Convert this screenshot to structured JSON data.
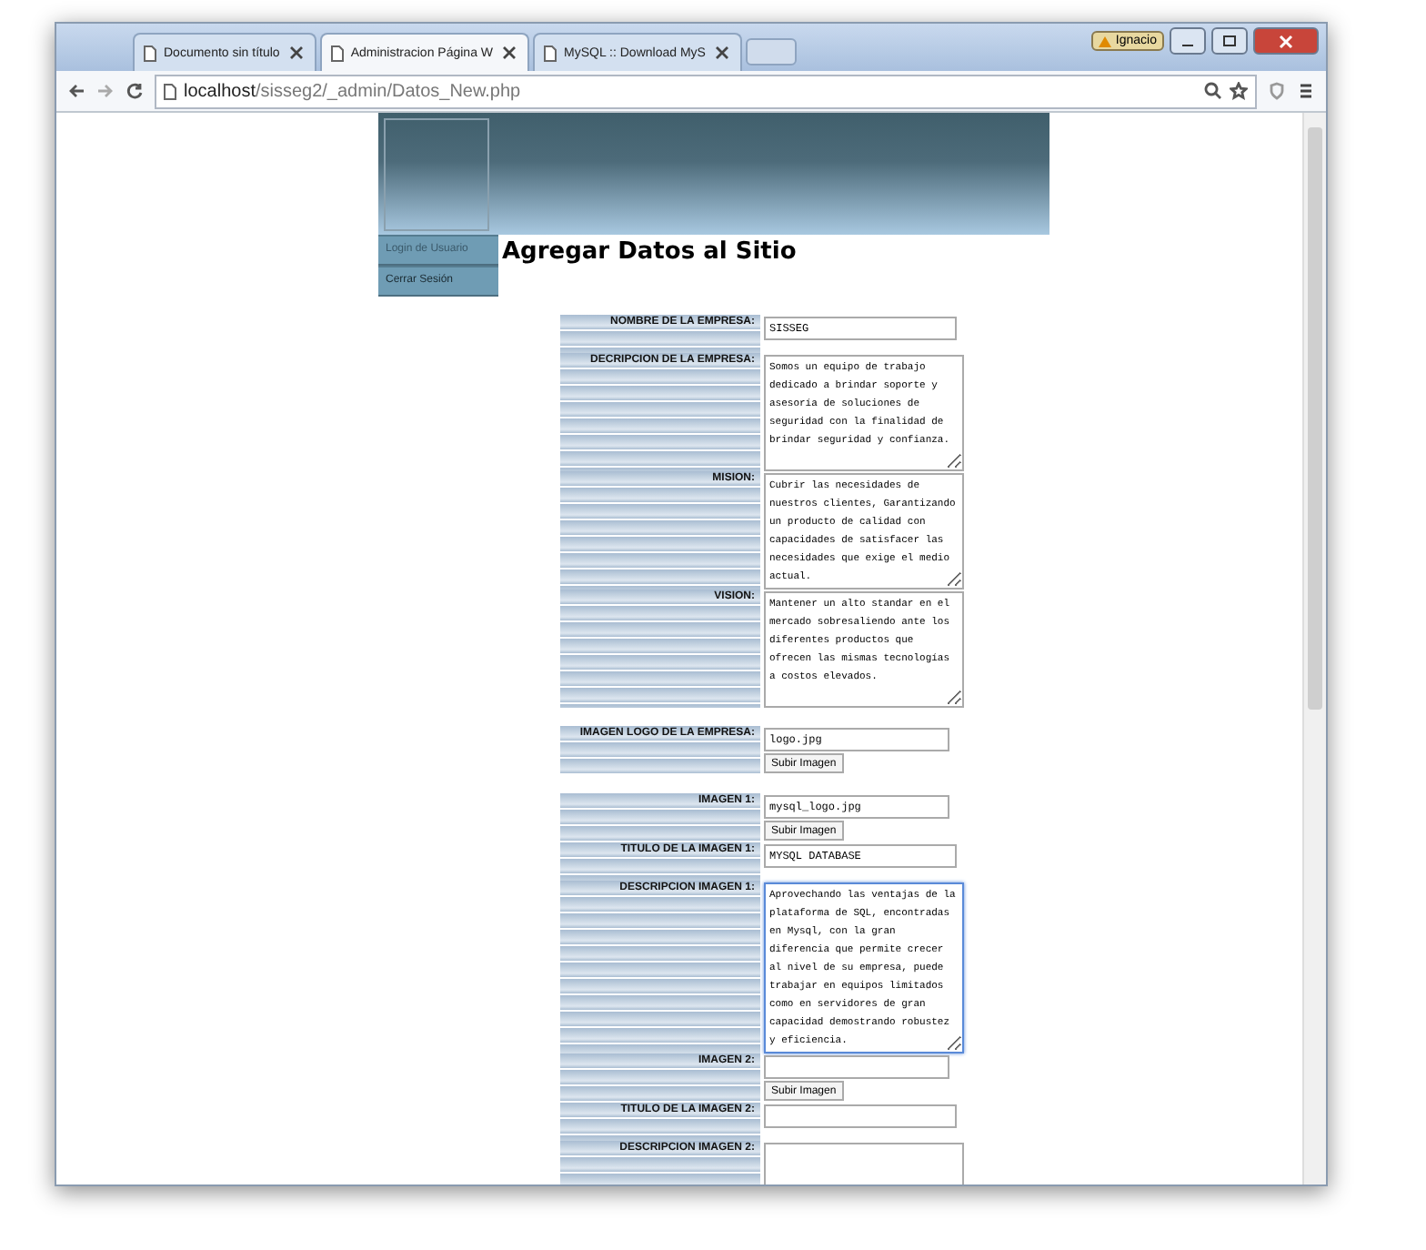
{
  "browser": {
    "tabs": [
      {
        "title": "Documento sin título",
        "selected": false
      },
      {
        "title": "Administracion Página W",
        "selected": true
      },
      {
        "title": "MySQL :: Download MyS",
        "selected": false
      }
    ],
    "profile": "Ignacio",
    "address": {
      "host": "localhost",
      "path": "/sisseg2/_admin/Datos_New.php"
    }
  },
  "menu": [
    {
      "label": "Login de Usuario",
      "disabled": true
    },
    {
      "label": "Cerrar Sesión",
      "disabled": false
    }
  ],
  "heading": "Agregar Datos al Sitio",
  "groups": [
    [
      {
        "kind": "text",
        "label": "NOMBRE DE LA EMPRESA:",
        "value": "SISSEG"
      },
      {
        "kind": "textarea",
        "label": "DECRIPCION DE LA EMPRESA:",
        "value": "Somos un equipo de trabajo dedicado a brindar soporte y asesoría de soluciones de seguridad con la finalidad de brindar seguridad y confianza.",
        "focused": false
      },
      {
        "kind": "textarea",
        "label": "MISION:",
        "value": "Cubrir las necesidades de nuestros clientes, Garantizando un producto de calidad con capacidades de satisfacer las necesidades que exige el medio actual.",
        "focused": false
      },
      {
        "kind": "textarea",
        "label": "VISION:",
        "value": "Mantener un alto standar en el mercado sobresaliendo ante los diferentes productos que ofrecen las mismas tecnologías a costos elevados.",
        "focused": false
      }
    ],
    [
      {
        "kind": "file",
        "label": "IMAGEN LOGO DE LA EMPRESA:",
        "value": "logo.jpg",
        "button": "Subir Imagen"
      }
    ],
    [
      {
        "kind": "file",
        "label": "IMAGEN 1:",
        "value": "mysql_logo.jpg",
        "button": "Subir Imagen"
      },
      {
        "kind": "text",
        "label": "TITULO DE LA IMAGEN 1:",
        "value": "MYSQL DATABASE"
      },
      {
        "kind": "textarea",
        "label": "DESCRIPCION IMAGEN 1:",
        "value": "Aprovechando las ventajas de la plataforma de SQL, encontradas en Mysql, con la gran diferencia que permite crecer al nivel de su empresa, puede trabajar en equipos limitados como en servidores de gran capacidad demostrando robustez y eficiencia.",
        "focused": true
      },
      {
        "kind": "file",
        "label": "IMAGEN 2:",
        "button": "Subir Imagen"
      },
      {
        "kind": "text",
        "label": "TITULO DE LA IMAGEN 2:"
      },
      {
        "kind": "textarea",
        "label": "DESCRIPCION IMAGEN 2:"
      }
    ]
  ]
}
